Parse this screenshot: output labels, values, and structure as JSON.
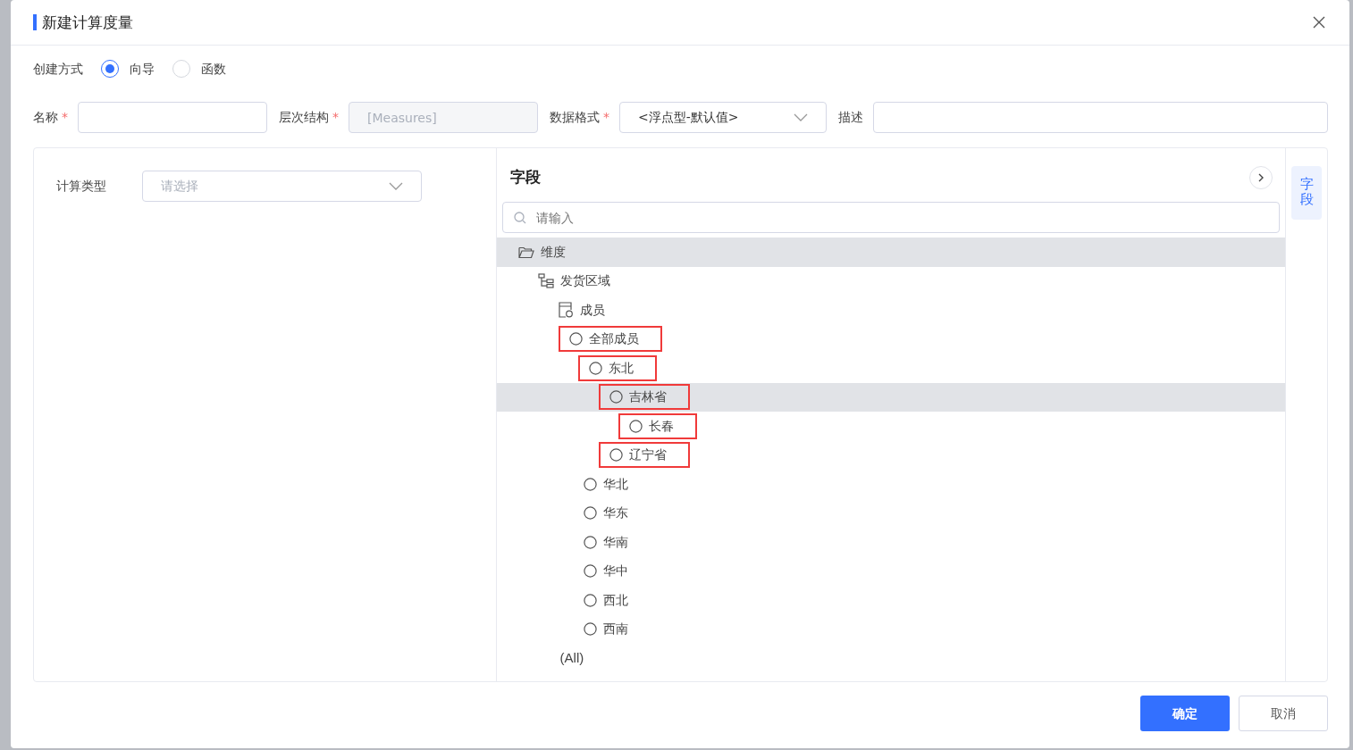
{
  "dialog": {
    "title": "新建计算度量"
  },
  "creation_method": {
    "label": "创建方式",
    "options": [
      {
        "label": "向导",
        "selected": true
      },
      {
        "label": "函数",
        "selected": false
      }
    ]
  },
  "fields": [
    {
      "label": "名称",
      "required_mark": "*",
      "kind": "input"
    },
    {
      "label": "层次结构",
      "required_mark": "*",
      "kind": "disabled",
      "value": "[Measures]"
    },
    {
      "label": "数据格式",
      "required_mark": "*",
      "kind": "select",
      "value": "<浮点型-默认值>"
    },
    {
      "label": "描述",
      "kind": "input"
    }
  ],
  "calc_type": {
    "label": "计算类型",
    "placeholder": "请选择"
  },
  "fields_panel": {
    "title": "字段",
    "search_placeholder": "请输入",
    "tree": [
      {
        "label": "维度",
        "kind": "folder",
        "selected": true,
        "highlighted": false,
        "children": [
          {
            "label": "发货区域",
            "kind": "hierarchy",
            "selected": false,
            "highlighted": false,
            "children": [
              {
                "label": "成员",
                "kind": "member",
                "selected": false,
                "highlighted": false,
                "children": [
                  {
                    "label": "全部成员",
                    "kind": "radio",
                    "selected": false,
                    "highlighted": true,
                    "children": [
                      {
                        "label": "东北",
                        "kind": "radio",
                        "selected": false,
                        "highlighted": true,
                        "children": [
                          {
                            "label": "吉林省",
                            "kind": "radio",
                            "selected": true,
                            "highlighted": true,
                            "children": [
                              {
                                "label": "长春",
                                "kind": "radio",
                                "selected": false,
                                "highlighted": true
                              }
                            ]
                          },
                          {
                            "label": "辽宁省",
                            "kind": "radio",
                            "selected": false,
                            "highlighted": true
                          }
                        ]
                      },
                      {
                        "label": "华北",
                        "kind": "radio",
                        "selected": false,
                        "highlighted": false
                      },
                      {
                        "label": "华东",
                        "kind": "radio",
                        "selected": false,
                        "highlighted": false
                      },
                      {
                        "label": "华南",
                        "kind": "radio",
                        "selected": false,
                        "highlighted": false
                      },
                      {
                        "label": "华中",
                        "kind": "radio",
                        "selected": false,
                        "highlighted": false
                      },
                      {
                        "label": "西北",
                        "kind": "radio",
                        "selected": false,
                        "highlighted": false
                      },
                      {
                        "label": "西南",
                        "kind": "radio",
                        "selected": false,
                        "highlighted": false
                      }
                    ]
                  }
                ]
              },
              {
                "label": "(All)",
                "kind": "plain",
                "selected": false,
                "highlighted": false
              }
            ]
          }
        ]
      }
    ]
  },
  "side_tab": {
    "label": "字段"
  },
  "buttons": [
    {
      "label": "确定",
      "kind": "primary"
    },
    {
      "label": "取消",
      "kind": "secondary"
    }
  ]
}
